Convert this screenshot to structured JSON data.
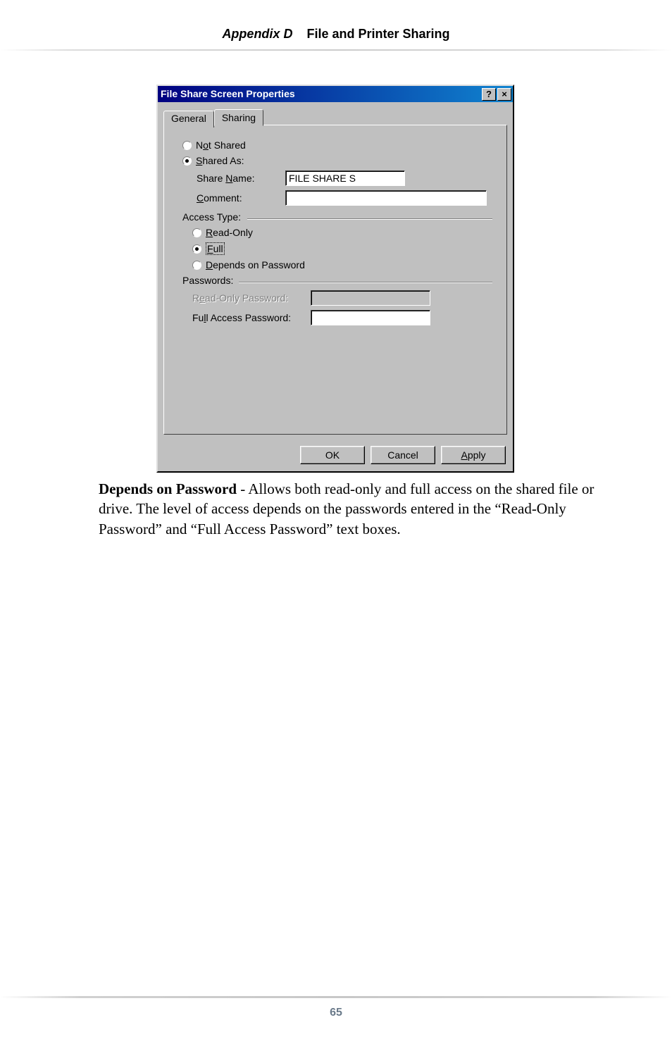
{
  "header": {
    "appendix": "Appendix D",
    "title": "File and Printer Sharing"
  },
  "dialog": {
    "title": "File Share Screen Properties",
    "help_icon": "?",
    "close_icon": "×",
    "tabs": {
      "general": "General",
      "sharing": "Sharing"
    },
    "radios": {
      "not_shared_prefix": "N",
      "not_shared_underline": "o",
      "not_shared_suffix": "t Shared",
      "shared_as_underline": "S",
      "shared_as_suffix": "hared As:"
    },
    "fields": {
      "share_name_label_pre": "Share ",
      "share_name_label_u": "N",
      "share_name_label_post": "ame:",
      "share_name_value": "FILE SHARE S",
      "comment_label_u": "C",
      "comment_label_post": "omment:",
      "comment_value": ""
    },
    "access": {
      "legend": "Access Type:",
      "readonly_u": "R",
      "readonly_post": "ead-Only",
      "full_u": "F",
      "full_post": "ull",
      "depends_u": "D",
      "depends_post": "epends on Password"
    },
    "passwords": {
      "legend": "Passwords:",
      "readonly_label_pre": "R",
      "readonly_label_u": "e",
      "readonly_label_post": "ad-Only Password:",
      "readonly_value": "",
      "full_label_pre": "Fu",
      "full_label_u": "l",
      "full_label_post": "l Access Password:",
      "full_value": ""
    },
    "buttons": {
      "ok": "OK",
      "cancel": "Cancel",
      "apply_u": "A",
      "apply_post": "pply"
    }
  },
  "paragraph": {
    "lead": "Depends on Password",
    "rest": " - Allows both read-only and full access on the shared file or drive. The level of access depends on the passwords entered in the “Read-Only Password” and “Full Access Password” text boxes."
  },
  "page_number": "65"
}
